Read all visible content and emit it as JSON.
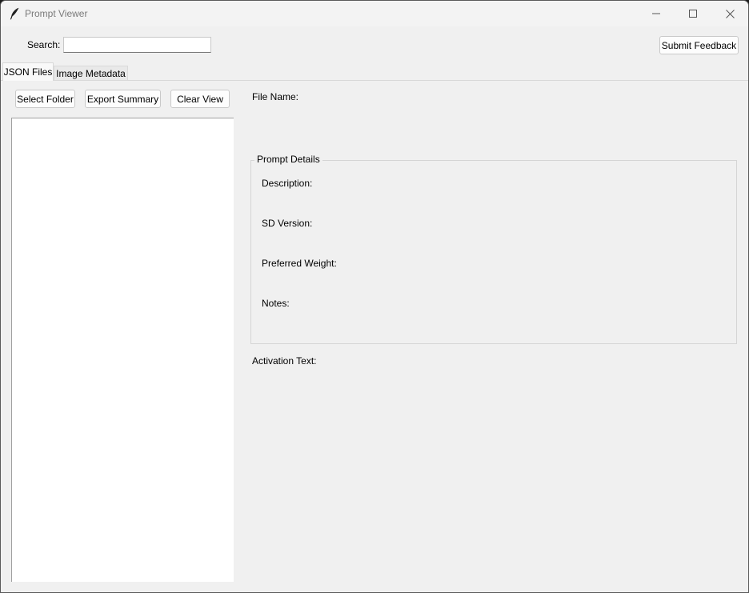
{
  "window": {
    "title": "Prompt Viewer",
    "icon": "feather-icon"
  },
  "search": {
    "label": "Search:",
    "value": "",
    "placeholder": ""
  },
  "toolbar": {
    "submit_feedback_label": "Submit Feedback"
  },
  "tabs": [
    {
      "label": "JSON Files",
      "selected": true
    },
    {
      "label": "Image Metadata",
      "selected": false
    }
  ],
  "left_panel": {
    "select_folder_label": "Select Folder",
    "export_summary_label": "Export Summary",
    "clear_view_label": "Clear View",
    "files": []
  },
  "details": {
    "file_name_label": "File Name:",
    "group_title": "Prompt Details",
    "description_label": "Description:",
    "sd_version_label": "SD Version:",
    "preferred_weight_label": "Preferred Weight:",
    "notes_label": "Notes:",
    "activation_text_label": "Activation Text:"
  }
}
